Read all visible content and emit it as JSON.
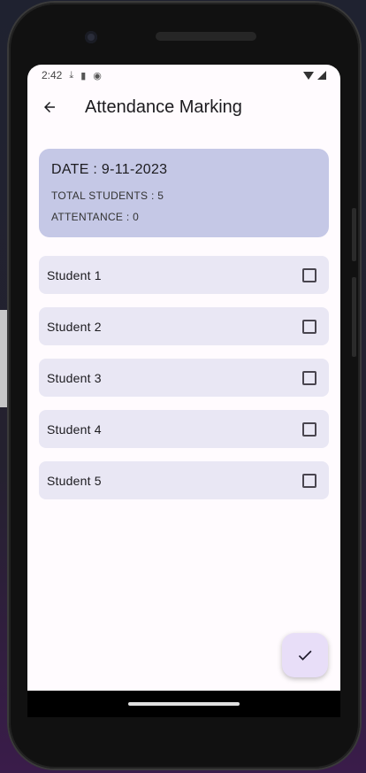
{
  "status_bar": {
    "time": "2:42",
    "icons": [
      "download-icon",
      "sd-card-icon",
      "sync-icon",
      "wifi-icon",
      "signal-icon"
    ]
  },
  "app_bar": {
    "back_icon": "arrow-left-icon",
    "title": "Attendance Marking"
  },
  "summary": {
    "date": "DATE : 9-11-2023",
    "total_students": "TOTAL STUDENTS : 5",
    "attendance": "ATTENTANCE : 0"
  },
  "students": [
    {
      "name": "Student 1",
      "checked": false
    },
    {
      "name": "Student 2",
      "checked": false
    },
    {
      "name": "Student 3",
      "checked": false
    },
    {
      "name": "Student 4",
      "checked": false
    },
    {
      "name": "Student 5",
      "checked": false
    }
  ],
  "fab": {
    "icon": "check-icon"
  },
  "colors": {
    "summary_card": "#c5c8e6",
    "row_background": "#e9e7f4",
    "fab_background": "#e8def8",
    "screen_background": "#fffbfe"
  }
}
